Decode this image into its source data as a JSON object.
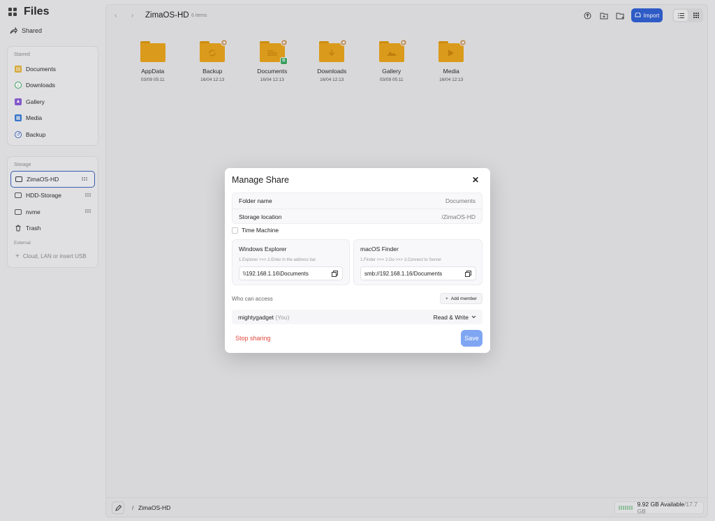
{
  "app": {
    "title": "Files"
  },
  "sidebar": {
    "shared_label": "Shared",
    "starred": {
      "label": "Starred",
      "items": [
        {
          "label": "Documents",
          "icon": "document-icon",
          "color": "#e2b13c"
        },
        {
          "label": "Downloads",
          "icon": "download-icon",
          "color": "#3aa663"
        },
        {
          "label": "Gallery",
          "icon": "image-icon",
          "color": "#8b5cd6"
        },
        {
          "label": "Media",
          "icon": "media-icon",
          "color": "#3a7bd5"
        },
        {
          "label": "Backup",
          "icon": "backup-icon",
          "color": "#3a62b8"
        }
      ]
    },
    "storage": {
      "label": "Storage",
      "items": [
        {
          "label": "ZimaOS-HD",
          "active": true
        },
        {
          "label": "HDD-Storage"
        },
        {
          "label": "nvme"
        },
        {
          "label": "Trash"
        }
      ],
      "external_label": "External",
      "add_external": "Cloud, LAN or insert USB"
    }
  },
  "toolbar": {
    "folder_title": "ZimaOS-HD",
    "item_count": "6 items",
    "import_label": "Import",
    "accent": "#2f5fd1"
  },
  "files": [
    {
      "name": "AppData",
      "date": "03/09 05:11",
      "starred": false
    },
    {
      "name": "Backup",
      "date": "16/04 12:13",
      "starred": true
    },
    {
      "name": "Documents",
      "date": "16/04 12:13",
      "starred": true,
      "shared": true
    },
    {
      "name": "Downloads",
      "date": "16/04 12:13",
      "starred": true
    },
    {
      "name": "Gallery",
      "date": "03/09 05:11",
      "starred": true
    },
    {
      "name": "Media",
      "date": "16/04 12:13",
      "starred": true
    }
  ],
  "bottombar": {
    "path_sep": "/",
    "path": "ZimaOS-HD",
    "available": "9.92 GB Available",
    "total": "/17.7 GB"
  },
  "modal": {
    "title": "Manage Share",
    "folder_name_label": "Folder name",
    "folder_name_value": "Documents",
    "storage_location_label": "Storage location",
    "storage_location_value": "/ZimaOS-HD",
    "time_machine_label": "Time Machine",
    "windows": {
      "title": "Windows Explorer",
      "steps": "1.Explorer    >>>    2.Enter in the address bar",
      "address": "\\\\192.168.1.16\\Documents"
    },
    "mac": {
      "title": "macOS Finder",
      "steps": "1.Finder    >>>    2.Go    >>>    3.Connect to Server",
      "address": "smb://192.168.1.16/Documents"
    },
    "access_label": "Who can access",
    "add_member_label": "Add member",
    "member": {
      "name": "mightygadget",
      "you": "(You)",
      "permission": "Read & Write"
    },
    "stop_sharing_label": "Stop sharing",
    "save_label": "Save"
  }
}
